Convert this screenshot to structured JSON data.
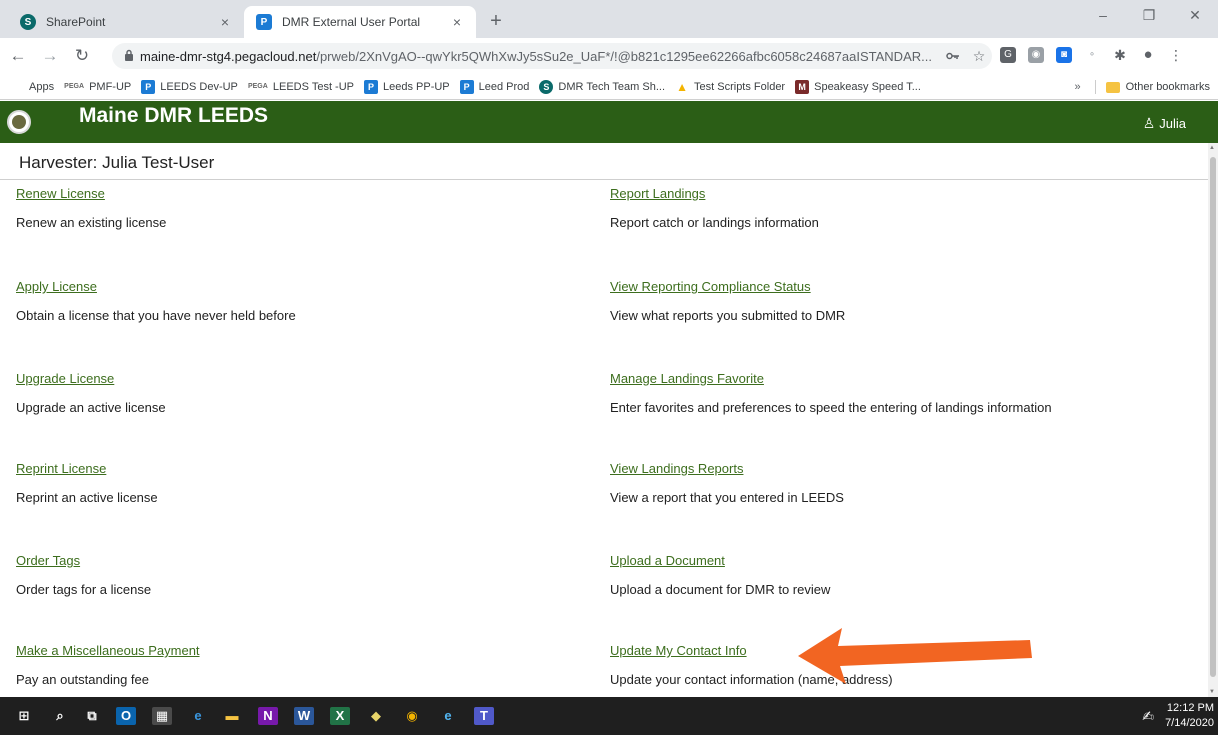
{
  "browser": {
    "tabs": [
      {
        "title": "SharePoint",
        "close": "×",
        "favicon": "S"
      },
      {
        "title": "DMR External User Portal",
        "close": "×",
        "favicon": "P"
      }
    ],
    "new_tab": "+",
    "window_controls": {
      "minimize": "–",
      "restore": "❐",
      "close": "✕"
    },
    "nav": {
      "back": "←",
      "forward": "→",
      "reload": "↻"
    },
    "url_host": "maine-dmr-stg4.pegacloud.net",
    "url_path": "/prweb/2XnVgAO--qwYkr5QWhXwJy5sSu2e_UaF*/!@b821c1295ee62266afbc6058c24687aaISTANDAR...",
    "extensions": [
      {
        "label": "G",
        "color": "#5f6368"
      },
      {
        "label": "◉",
        "color": "#9aa0a6"
      },
      {
        "label": "◙",
        "color": "#1a73e8"
      },
      {
        "label": "∘",
        "color": "#ffffff"
      }
    ]
  },
  "bookmarks": [
    {
      "label": "Apps",
      "icon": "⁝⁝⁝",
      "kind": "apps"
    },
    {
      "label": "PMF-UP",
      "icon": "PEGA",
      "kind": "pega"
    },
    {
      "label": "LEEDS Dev-UP",
      "icon": "P",
      "kind": "p"
    },
    {
      "label": "LEEDS Test -UP",
      "icon": "PEGA",
      "kind": "pega"
    },
    {
      "label": "Leeds PP-UP",
      "icon": "P",
      "kind": "p"
    },
    {
      "label": "Leed Prod",
      "icon": "P",
      "kind": "p"
    },
    {
      "label": "DMR Tech Team Sh...",
      "icon": "S",
      "kind": "sp"
    },
    {
      "label": "Test Scripts Folder",
      "icon": "▲",
      "kind": "drive"
    },
    {
      "label": "Speakeasy Speed T...",
      "icon": "M",
      "kind": "se"
    }
  ],
  "bookmarks_more": "»",
  "bookmarks_other": "Other bookmarks",
  "app": {
    "title": "Maine DMR LEEDS",
    "user_name": "Julia",
    "user_icon": "♙"
  },
  "harvester_label": "Harvester:  Julia Test-User",
  "actions_left": [
    {
      "link": "Renew License",
      "desc": "Renew an existing license"
    },
    {
      "link": "Apply License",
      "desc": "Obtain a license that you have never held before"
    },
    {
      "link": "Upgrade License",
      "desc": "Upgrade an active license"
    },
    {
      "link": "Reprint License",
      "desc": "Reprint an active license"
    },
    {
      "link": "Order Tags",
      "desc": "Order tags for a license"
    },
    {
      "link": "Make a Miscellaneous Payment",
      "desc": "Pay an outstanding fee"
    }
  ],
  "actions_right": [
    {
      "link": "Report Landings",
      "desc": "Report catch or landings information"
    },
    {
      "link": "View Reporting Compliance Status",
      "desc": "View what reports you submitted to DMR"
    },
    {
      "link": "Manage Landings Favorite",
      "desc": "Enter favorites and preferences to speed the entering of landings information"
    },
    {
      "link": "View Landings Reports",
      "desc": "View a report that you entered in LEEDS"
    },
    {
      "link": "Upload a Document",
      "desc": "Upload a document for DMR to review"
    },
    {
      "link": "Update My Contact Info",
      "desc": "Update your contact information (name, address)"
    }
  ],
  "annotation_arrow_color": "#f26522",
  "colors": {
    "header_green": "#2b5e16",
    "link_green": "#3d6e1e"
  },
  "taskbar": {
    "icons": [
      {
        "label": "⊞",
        "name": "windows-start-icon",
        "color": "#ffffff",
        "bg": "transparent"
      },
      {
        "label": "⌕",
        "name": "search-icon",
        "color": "#ffffff",
        "bg": "transparent"
      },
      {
        "label": "⧉",
        "name": "task-view-icon",
        "color": "#ffffff",
        "bg": "transparent"
      },
      {
        "label": "O",
        "name": "outlook-icon",
        "color": "#ffffff",
        "bg": "#0a64ad"
      },
      {
        "label": "▦",
        "name": "calculator-icon",
        "color": "#ffffff",
        "bg": "#4a4a4a"
      },
      {
        "label": "e",
        "name": "edge-icon",
        "color": "#3a96dd",
        "bg": "transparent"
      },
      {
        "label": "▬",
        "name": "file-explorer-icon",
        "color": "#f5c342",
        "bg": "transparent"
      },
      {
        "label": "N",
        "name": "onenote-icon",
        "color": "#ffffff",
        "bg": "#7719aa"
      },
      {
        "label": "W",
        "name": "word-icon",
        "color": "#ffffff",
        "bg": "#2b579a"
      },
      {
        "label": "X",
        "name": "excel-icon",
        "color": "#ffffff",
        "bg": "#217346"
      },
      {
        "label": "◆",
        "name": "snipping-icon",
        "color": "#e8d56a",
        "bg": "transparent"
      },
      {
        "label": "◉",
        "name": "chrome-icon",
        "color": "#f4b400",
        "bg": "transparent"
      },
      {
        "label": "e",
        "name": "internet-explorer-icon",
        "color": "#52b5f0",
        "bg": "transparent"
      },
      {
        "label": "T",
        "name": "teams-icon",
        "color": "#ffffff",
        "bg": "#5059c9"
      }
    ],
    "time": "12:12 PM",
    "date": "7/14/2020",
    "pen_icon": "✍"
  }
}
